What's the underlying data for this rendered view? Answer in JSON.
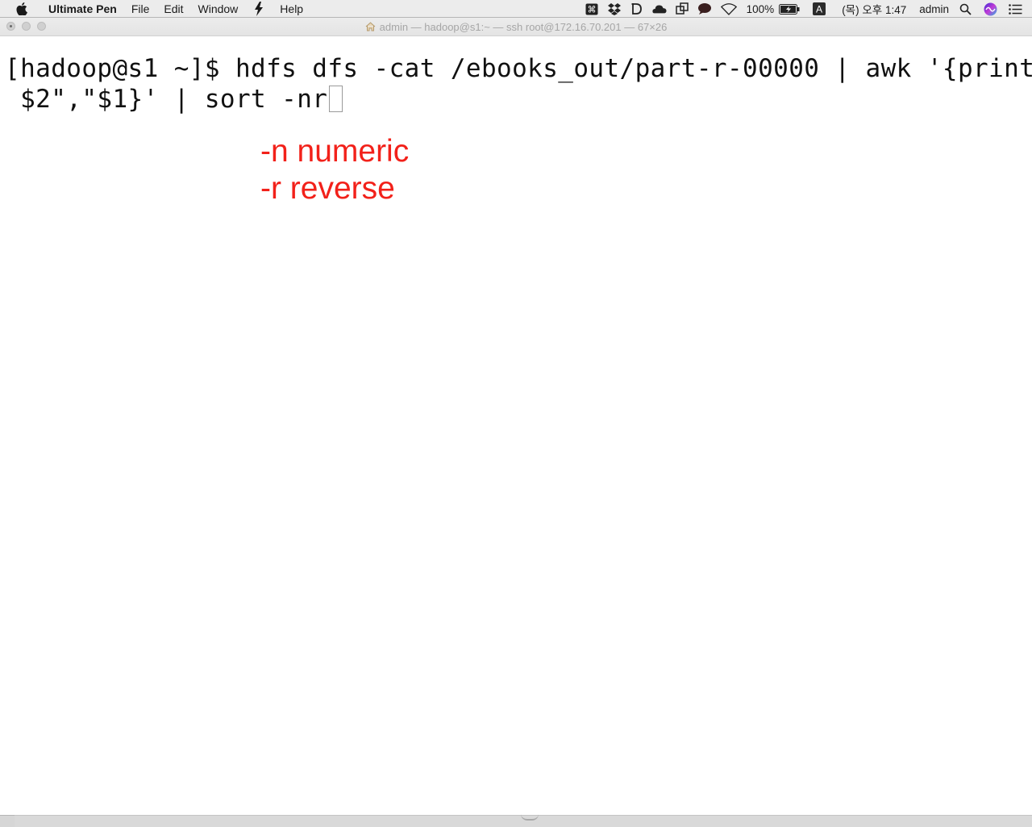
{
  "menubar": {
    "app_name": "Ultimate Pen",
    "items": [
      "File",
      "Edit",
      "Window",
      "Help"
    ],
    "battery": "100%",
    "input_source": "A",
    "clock": "(목) 오후 1:47",
    "user": "admin",
    "icons": [
      "apple-icon",
      "scripting-icon",
      "command-icon",
      "dropbox-icon",
      "d-icon",
      "cloud-icon",
      "window-icon",
      "speech-bubble-icon",
      "wifi-icon",
      "battery-icon",
      "input-source-icon",
      "search-icon",
      "siri-icon",
      "list-icon"
    ]
  },
  "window": {
    "title": "admin — hadoop@s1:~ — ssh root@172.16.70.201 — 67×26"
  },
  "terminal": {
    "line1": "[hadoop@s1 ~]$ hdfs dfs -cat /ebooks_out/part-r-00000 | awk '{print",
    "line2": " $2\",\"$1}' | sort -nr"
  },
  "annotations": {
    "line1": "-n numeric",
    "line2": "-r reverse",
    "color": "#f2211a"
  }
}
